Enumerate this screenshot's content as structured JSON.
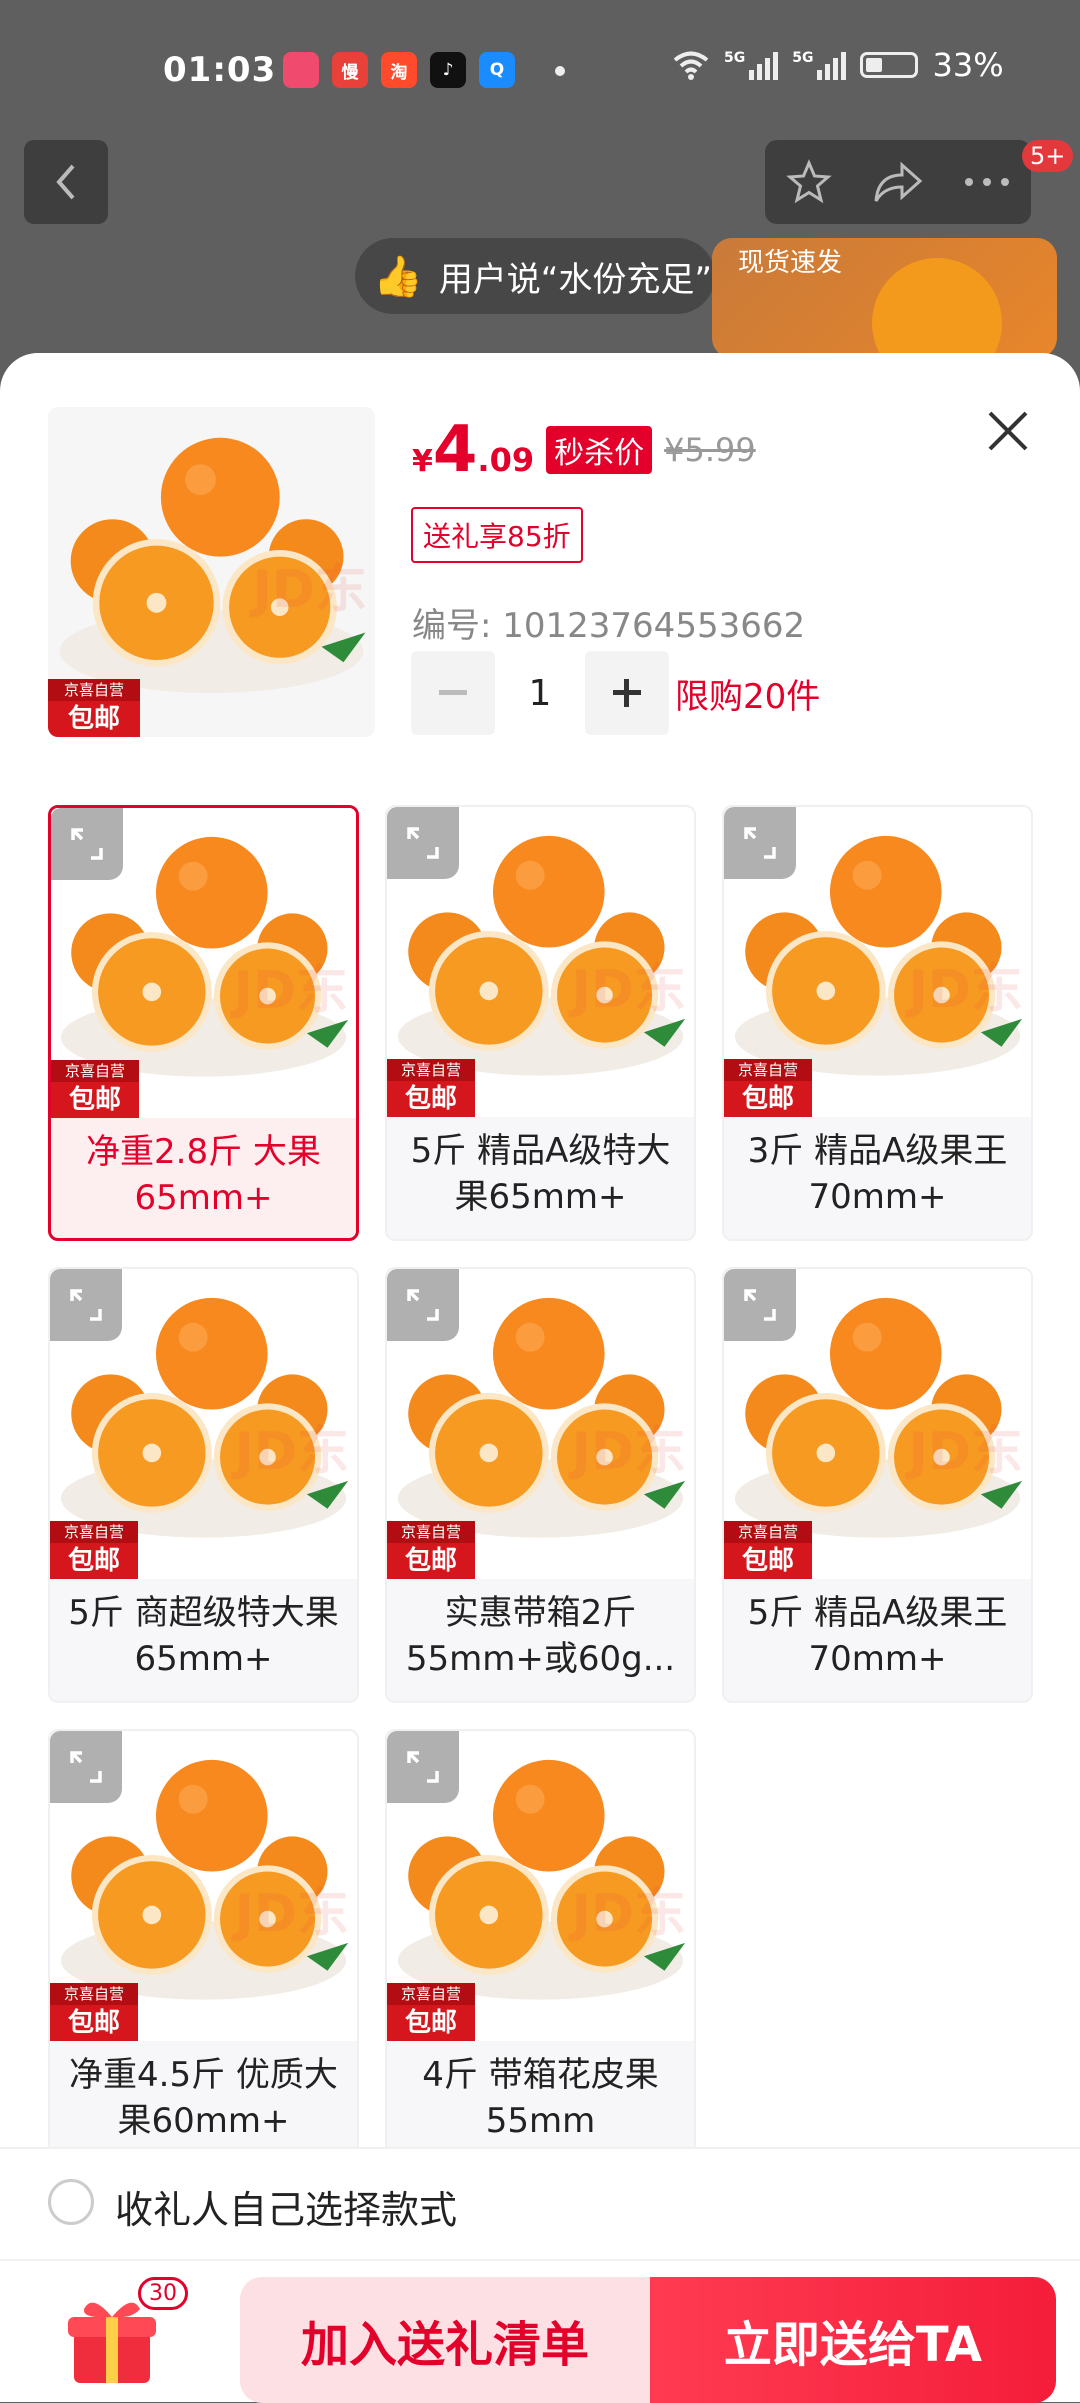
{
  "status_bar": {
    "time": "01:03",
    "app_icons": [
      {
        "name": "app-1-icon",
        "label": "",
        "color": "#f04b6e"
      },
      {
        "name": "app-2-icon",
        "label": "慢",
        "color": "#e8413a"
      },
      {
        "name": "taobao-icon",
        "label": "淘",
        "color": "#ff4b2b"
      },
      {
        "name": "tiktok-icon",
        "label": "♪",
        "color": "#111111"
      },
      {
        "name": "search-app-icon",
        "label": "Q",
        "color": "#1a8cff"
      }
    ],
    "battery": "33%",
    "net1": "5G",
    "net2": "5G"
  },
  "header": {
    "badge": "5+",
    "promo_text": "用户说“水份充足”",
    "promo_tag": "现货速发"
  },
  "product": {
    "currency": "¥",
    "price_int": "4",
    "price_dec": ".09",
    "seckill_label": "秒杀价",
    "original_price": "¥5.99",
    "gift_tag": "送礼享85折",
    "sku_label": "编号: 10123764553662",
    "quantity": "1",
    "limit": "限购20件",
    "tag_top": "京喜自营",
    "tag_bottom": "包邮",
    "watermark": "JD东"
  },
  "variants": [
    {
      "label": "净重2.8斤 大果65mm+",
      "selected": true
    },
    {
      "label": "5斤 精品A级特大果65mm+",
      "selected": false
    },
    {
      "label": "3斤 精品A级果王70mm+",
      "selected": false
    },
    {
      "label": "5斤 商超级特大果65mm+",
      "selected": false
    },
    {
      "label": "实惠带箱2斤55mm+或60g...",
      "selected": false
    },
    {
      "label": "5斤 精品A级果王70mm+",
      "selected": false
    },
    {
      "label": "净重4.5斤 优质大果60mm+",
      "selected": false
    },
    {
      "label": "4斤 带箱花皮果55mm",
      "selected": false
    }
  ],
  "bottom": {
    "option_label": "收礼人自己选择款式",
    "gift_count": "30",
    "add_button": "加入送礼清单",
    "send_button": "立即送给TA"
  },
  "colors": {
    "accent": "#e3002b",
    "orange": "#f6871f"
  }
}
